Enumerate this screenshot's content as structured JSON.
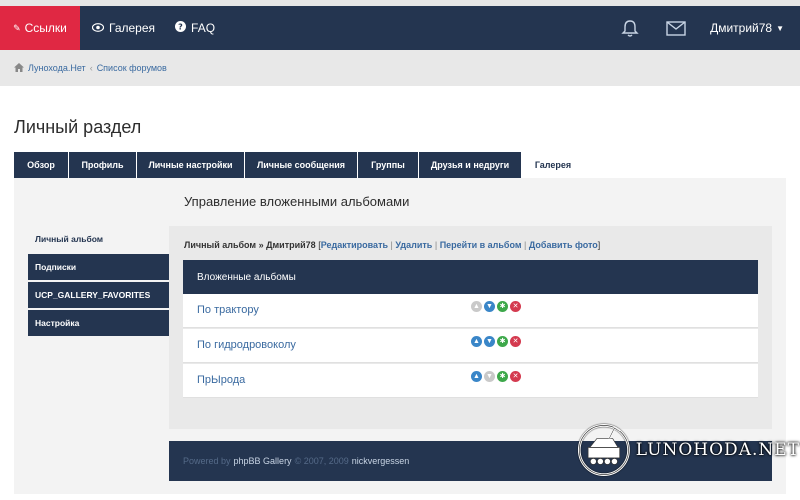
{
  "header": {
    "links_label": "Ссылки",
    "gallery_label": "Галерея",
    "faq_label": "FAQ",
    "username": "Дмитрий78"
  },
  "breadcrumb": {
    "home": "Лунохода.Нет",
    "forums": "Список форумов"
  },
  "page_title": "Личный раздел",
  "tabs": [
    {
      "label": "Обзор"
    },
    {
      "label": "Профиль"
    },
    {
      "label": "Личные настройки"
    },
    {
      "label": "Личные сообщения"
    },
    {
      "label": "Группы"
    },
    {
      "label": "Друзья и недруги"
    },
    {
      "label": "Галерея"
    }
  ],
  "section_title": "Управление вложенными альбомами",
  "sidebar": {
    "items": [
      {
        "label": "Личный альбом"
      },
      {
        "label": "Подписки"
      },
      {
        "label": "UCP_GALLERY_FAVORITES"
      },
      {
        "label": "Настройка"
      }
    ]
  },
  "album_path": {
    "prefix": "Личный альбом » Дмитрий78",
    "edit": "Редактировать",
    "delete": "Удалить",
    "go": "Перейти в альбом",
    "add": "Добавить фото"
  },
  "table": {
    "header": "Вложенные альбомы",
    "rows": [
      {
        "name": "По трактору"
      },
      {
        "name": "По гидродровоколу"
      },
      {
        "name": "ПрЫрода"
      }
    ]
  },
  "footer": {
    "powered": "Powered by",
    "gallery": "phpBB Gallery",
    "copy": "© 2007, 2009",
    "author": "nickvergessen"
  },
  "watermark": "LUNOHODA.NET",
  "colors": {
    "navy": "#243550",
    "accent_red": "#e02843",
    "link_blue": "#3a6aa0"
  }
}
